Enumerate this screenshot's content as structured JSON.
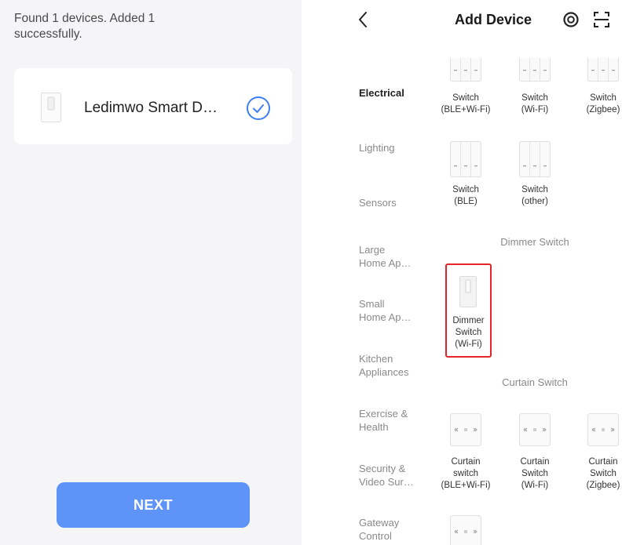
{
  "left_panel": {
    "status": {
      "line1": "Found 1 devices. Added 1",
      "line2": "successfully."
    },
    "device": {
      "name": "Ledimwo Smart D…",
      "image_icon": "switch-plate-icon",
      "status_icon": "check-circle-icon"
    },
    "next_button": {
      "label": "NEXT"
    }
  },
  "header": {
    "back_icon": "chevron-left-icon",
    "title": "Add Device",
    "right_icons": [
      "target-icon",
      "scan-icon"
    ]
  },
  "categories": [
    {
      "lines": [
        "Electrical"
      ],
      "selected": true
    },
    {
      "lines": [
        "Lighting"
      ],
      "selected": false
    },
    {
      "lines": [
        "Sensors"
      ],
      "selected": false
    },
    {
      "lines": [
        "Large",
        "Home Ap…"
      ],
      "selected": false
    },
    {
      "lines": [
        "Small",
        "Home Ap…"
      ],
      "selected": false
    },
    {
      "lines": [
        "Kitchen",
        "Appliances"
      ],
      "selected": false
    },
    {
      "lines": [
        "Exercise &",
        "Health"
      ],
      "selected": false
    },
    {
      "lines": [
        "Security &",
        "Video Sur…"
      ],
      "selected": false
    },
    {
      "lines": [
        "Gateway",
        "Control"
      ],
      "selected": false
    }
  ],
  "sections": [
    {
      "items": [
        {
          "lines": [
            "Switch",
            "(BLE+Wi-Fi)"
          ],
          "icon": "switch-3gang-icon"
        },
        {
          "lines": [
            "Switch",
            "(Wi-Fi)"
          ],
          "icon": "switch-3gang-icon"
        },
        {
          "lines": [
            "Switch",
            "(Zigbee)"
          ],
          "icon": "switch-3gang-icon"
        },
        {
          "lines": [
            "Switch",
            "(BLE)"
          ],
          "icon": "switch-3gang-icon"
        },
        {
          "lines": [
            "Switch",
            "(other)"
          ],
          "icon": "switch-3gang-icon"
        }
      ]
    },
    {
      "title": "Dimmer Switch",
      "items": [
        {
          "lines": [
            "Dimmer",
            "Switch",
            "(Wi-Fi)"
          ],
          "icon": "dimmer-switch-icon",
          "highlighted": true
        }
      ]
    },
    {
      "title": "Curtain Switch",
      "items": [
        {
          "lines": [
            "Curtain",
            "switch",
            "(BLE+Wi-Fi)"
          ],
          "icon": "curtain-switch-icon"
        },
        {
          "lines": [
            "Curtain",
            "Switch",
            "(Wi-Fi)"
          ],
          "icon": "curtain-switch-icon"
        },
        {
          "lines": [
            "Curtain",
            "Switch",
            "(Zigbee)"
          ],
          "icon": "curtain-switch-icon"
        },
        {
          "icon": "curtain-switch-icon"
        }
      ]
    }
  ],
  "colors": {
    "left_background": "#f5f5f7",
    "accent_blue": "#5e93f7",
    "check_blue": "#3f7ef3",
    "highlight_red": "#e3242b",
    "category_text": "#8a8a8a",
    "selected_category": "#1f1f1f"
  }
}
